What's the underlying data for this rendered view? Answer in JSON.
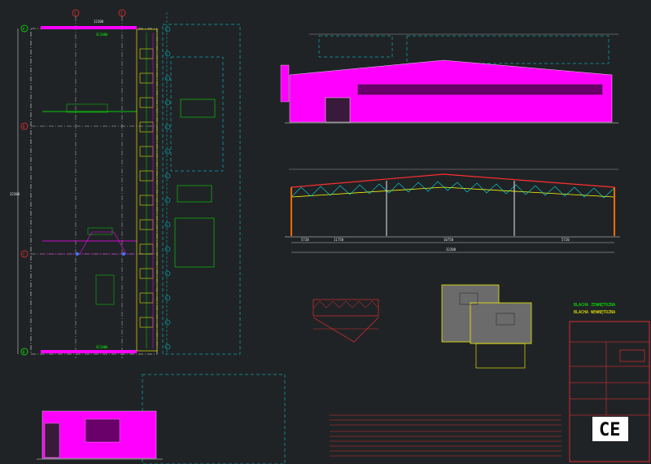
{
  "labels": {
    "plan_top": "ŚCIANA",
    "plan_bottom": "ŚCIANA",
    "axis_a": "A",
    "axis_b": "B",
    "axis_c": "C",
    "axis_d": "D",
    "axis_1": "1",
    "axis_2": "2",
    "dim_total": "32200",
    "dim_bays": [
      "5720",
      "10750",
      "10750",
      "5720"
    ],
    "dim_span": "12200",
    "section_total": "32200",
    "section_parts": [
      "5720",
      "11750",
      "10750",
      "5720"
    ],
    "legend_1": "BLACHA ZEWNĘTRZNA",
    "legend_2": "BLACHA WEWNĘTRZNA",
    "ce": "CE"
  },
  "colors": {
    "background": "#202326",
    "magenta": "#ff00ff",
    "yellow": "#ffff00",
    "cyan": "#00e5e5",
    "green": "#00ff00",
    "red": "#ff3030",
    "white": "#e8e8e8",
    "blue": "#3a7bff"
  }
}
